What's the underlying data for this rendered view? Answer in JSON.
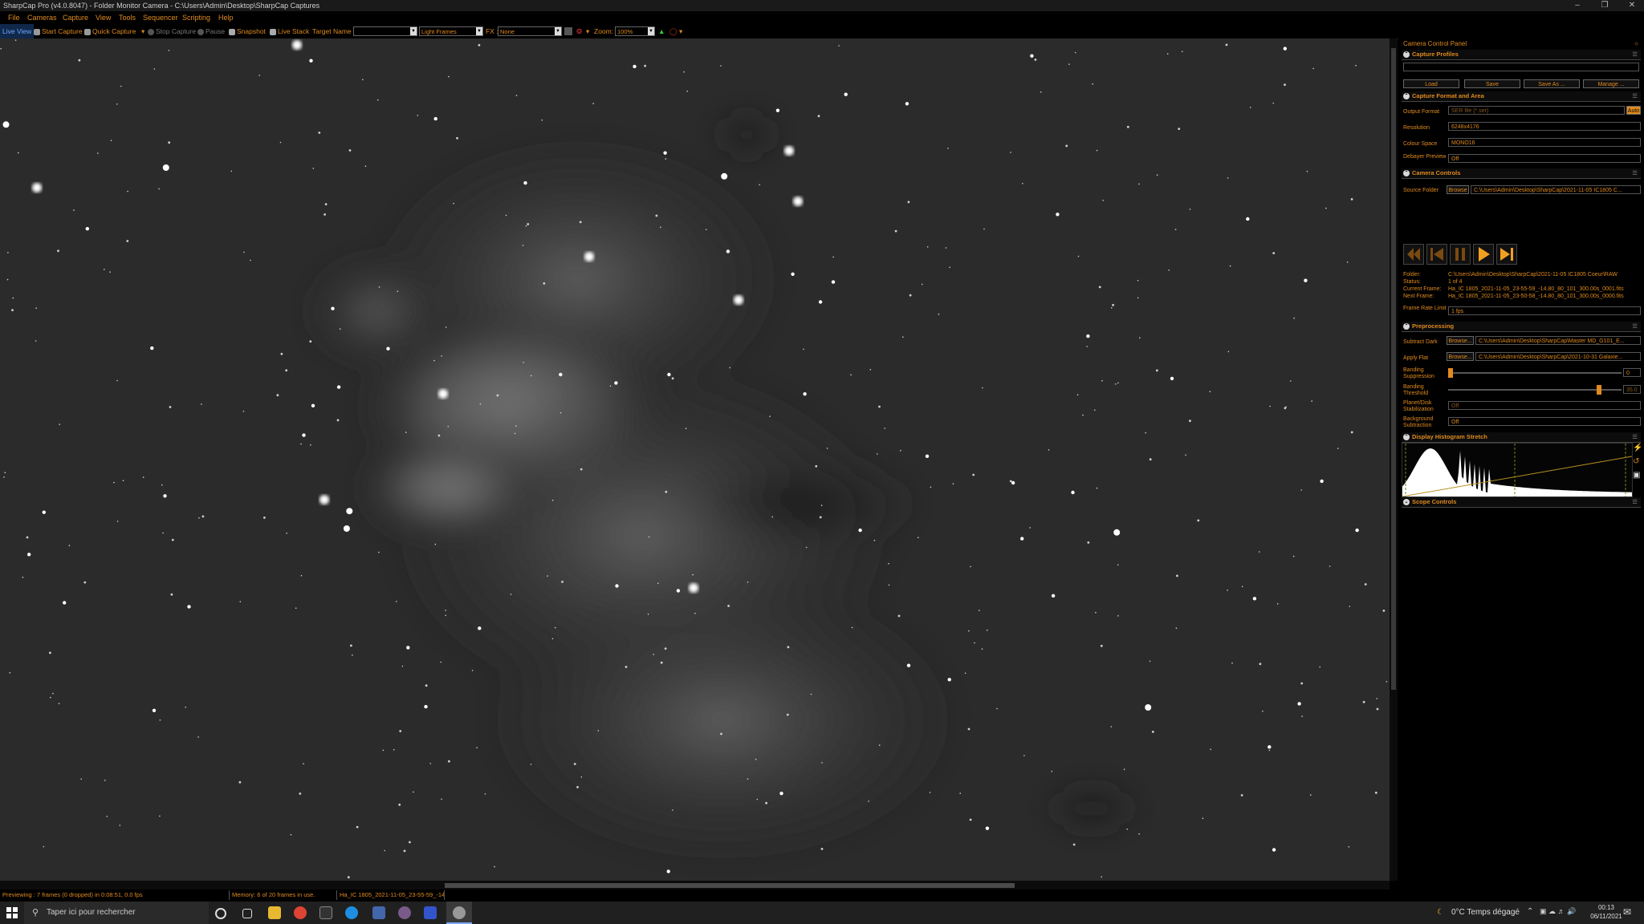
{
  "window": {
    "title": "SharpCap Pro (v4.0.8047) - Folder Monitor Camera - C:\\Users\\Admin\\Desktop\\SharpCap Captures"
  },
  "menu": [
    "File",
    "Cameras",
    "Capture",
    "View",
    "Tools",
    "Sequencer",
    "Scripting",
    "Help"
  ],
  "toolbar": {
    "live_view": "Live View",
    "start_capture": "Start Capture",
    "quick_capture": "Quick Capture",
    "stop_capture": "Stop Capture",
    "pause": "Pause",
    "snapshot": "Snapshot",
    "live_stack": "Live Stack",
    "target_name_label": "Target Name :",
    "target_name_value": "",
    "frame_type": "Light Frames",
    "fx_label": "FX :",
    "fx_value": "None",
    "zoom_label": "Zoom:",
    "zoom_value": "100%"
  },
  "status": {
    "previewing": "Previewing : 7 frames (0 dropped) in 0:08:51, 0.0 fps",
    "memory": "Memory: 6 of 20 frames in use.",
    "file": "Ha_IC 1805_2021-11-05_23-55-59_-14"
  },
  "panel": {
    "title": "Camera Control Panel",
    "capture_profiles": {
      "header": "Capture Profiles",
      "load": "Load",
      "save": "Save",
      "save_as": "Save As ...",
      "manage": "Manage ..."
    },
    "capture_format": {
      "header": "Capture Format and Area",
      "output_format_label": "Output Format",
      "output_format_value": "SER file (*.ser)",
      "auto": "Auto",
      "resolution_label": "Resolution",
      "resolution_value": "6248x4176",
      "colour_space_label": "Colour Space",
      "colour_space_value": "MONO16",
      "debayer_label": "Debayer Preview",
      "debayer_value": "Off"
    },
    "camera_controls": {
      "header": "Camera Controls",
      "source_folder_label": "Source Folder",
      "browse": "Browse",
      "source_folder_value": "C:\\Users\\Admin\\Desktop\\SharpCap\\2021-11-05 IC1805 C...",
      "folder_label": "Folder:",
      "folder_value": "C:\\Users\\Admin\\Desktop\\SharpCap\\2021-11-05 IC1805 Coeur\\RAW",
      "status_label": "Status:",
      "status_value": "1 of 4",
      "current_frame_label": "Current Frame:",
      "current_frame_value": "Ha_IC 1805_2021-11-05_23-55-59_-14.80_80_101_300.00s_0001.fits",
      "next_frame_label": "Next Frame:",
      "next_frame_value": "Ha_IC 1805_2021-11-05_23-50-58_-14.80_80_101_300.00s_0000.fits",
      "frame_rate_label": "Frame Rate Limit",
      "frame_rate_value": "1 fps"
    },
    "preprocessing": {
      "header": "Preprocessing",
      "subtract_dark_label": "Subtract Dark",
      "browse": "Browse...",
      "subtract_dark_value": "C:\\Users\\Admin\\Desktop\\SharpCap\\Master MD_G101_E...",
      "apply_flat_label": "Apply Flat",
      "apply_flat_value": "C:\\Users\\Admin\\Desktop\\SharpCap\\2021-10-31 Galaxie...",
      "banding_suppression_label": "Banding Suppression",
      "banding_suppression_value": "0",
      "banding_suppression_level": 0.0,
      "banding_threshold_label": "Banding Threshold",
      "banding_threshold_value": "35.0",
      "banding_threshold_level": 0.88,
      "planet_disk_label": "Planet/Disk Stabilization",
      "planet_disk_value": "Off",
      "background_label": "Background Subtraction",
      "background_value": "Off"
    },
    "histogram": {
      "header": "Display Histogram Stretch"
    },
    "scope": {
      "header": "Scope Controls"
    }
  },
  "taskbar": {
    "search_placeholder": "Taper ici pour rechercher",
    "weather": "0°C  Temps dégagé",
    "time": "00:13",
    "date": "06/11/2021"
  },
  "colors": {
    "accent": "#e08a1e",
    "background": "#000000"
  },
  "icons": [
    "windows-start-icon",
    "search-icon",
    "cortana-icon",
    "task-view-icon",
    "file-explorer-icon",
    "chrome-icon",
    "terminal-icon",
    "edge-icon",
    "app-icon",
    "sharpcap-icon",
    "notification-icon"
  ]
}
